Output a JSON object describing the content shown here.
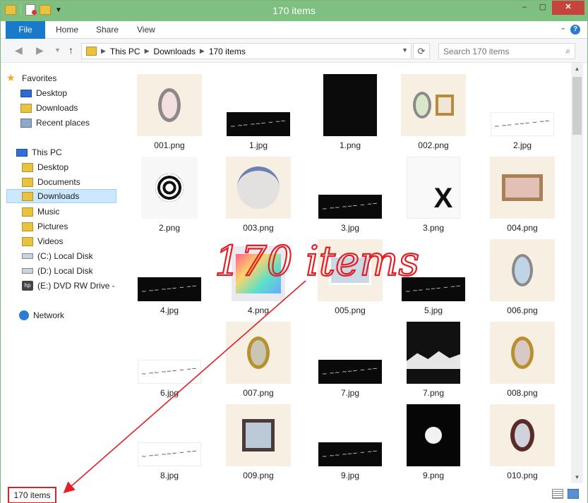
{
  "window": {
    "title": "170 items",
    "controls": {
      "minimize": "–",
      "maximize": "▢",
      "close": "✕"
    }
  },
  "ribbon": {
    "tabs": [
      "File",
      "Home",
      "Share",
      "View"
    ],
    "help": "?"
  },
  "address": {
    "crumbs": [
      "This PC",
      "Downloads",
      "170 items"
    ],
    "search_placeholder": "Search 170 items"
  },
  "sidebar": {
    "favorites_header": "Favorites",
    "favorites": [
      "Desktop",
      "Downloads",
      "Recent places"
    ],
    "pc_header": "This PC",
    "pc_items": [
      "Desktop",
      "Documents",
      "Downloads",
      "Music",
      "Pictures",
      "Videos",
      "(C:) Local Disk",
      "(D:) Local Disk",
      "(E:) DVD RW Drive -"
    ],
    "network": "Network"
  },
  "files": [
    {
      "name": "001.png",
      "kind": "cream-frame"
    },
    {
      "name": "1.jpg",
      "kind": "black-script"
    },
    {
      "name": "1.png",
      "kind": "black-tall"
    },
    {
      "name": "002.png",
      "kind": "cream-frames-2"
    },
    {
      "name": "2.jpg",
      "kind": "white-script"
    },
    {
      "name": "2.png",
      "kind": "circle-art"
    },
    {
      "name": "003.png",
      "kind": "cream-face"
    },
    {
      "name": "3.jpg",
      "kind": "black-script"
    },
    {
      "name": "3.png",
      "kind": "white-x"
    },
    {
      "name": "004.png",
      "kind": "cream-eye"
    },
    {
      "name": "4.jpg",
      "kind": "black-script"
    },
    {
      "name": "4.png",
      "kind": "colorful"
    },
    {
      "name": "005.png",
      "kind": "cream-photo"
    },
    {
      "name": "5.jpg",
      "kind": "black-script"
    },
    {
      "name": "006.png",
      "kind": "cream-frame-blue"
    },
    {
      "name": "6.jpg",
      "kind": "white-script"
    },
    {
      "name": "007.png",
      "kind": "cream-frame-gold"
    },
    {
      "name": "7.jpg",
      "kind": "black-script"
    },
    {
      "name": "7.png",
      "kind": "black-mountain"
    },
    {
      "name": "008.png",
      "kind": "cream-antlers"
    },
    {
      "name": "8.jpg",
      "kind": "white-script"
    },
    {
      "name": "009.png",
      "kind": "cream-clock"
    },
    {
      "name": "9.jpg",
      "kind": "black-script"
    },
    {
      "name": "9.png",
      "kind": "black-moon"
    },
    {
      "name": "010.png",
      "kind": "cream-frame-dark"
    }
  ],
  "status": {
    "count": "170 items"
  },
  "annotation": {
    "text": "170 items",
    "color": "#e31e24"
  }
}
